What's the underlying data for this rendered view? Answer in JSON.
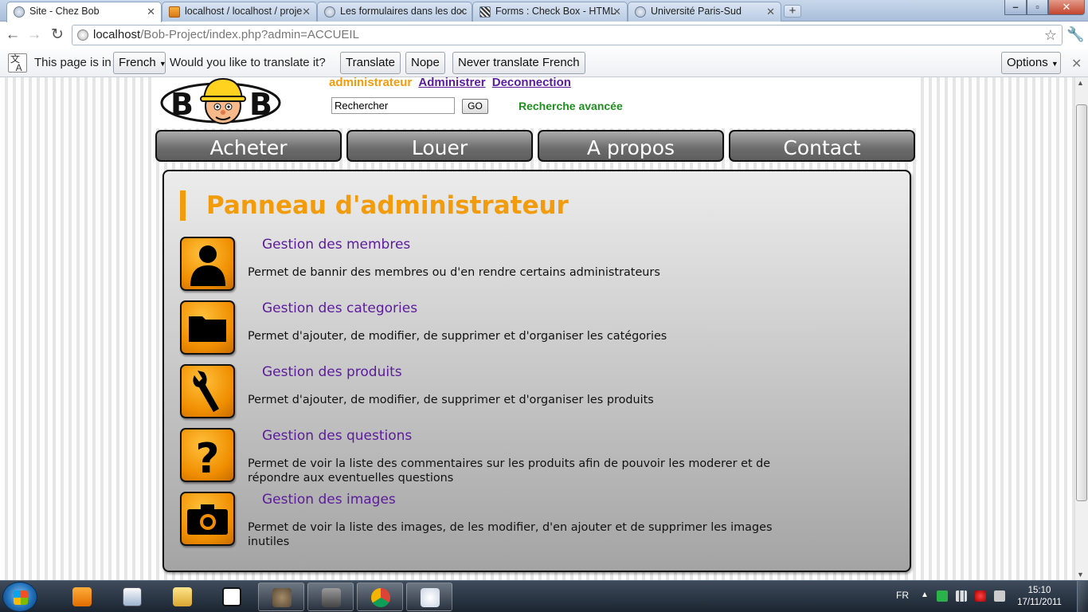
{
  "browser": {
    "tabs": [
      {
        "title": "Site - Chez Bob",
        "icon": "globe-icon",
        "active": true
      },
      {
        "title": "localhost / localhost / proje",
        "icon": "phpmyadmin-icon",
        "active": false
      },
      {
        "title": "Les formulaires dans les doc",
        "icon": "globe-icon",
        "active": false
      },
      {
        "title": "Forms : Check Box - HTML",
        "icon": "site-icon",
        "active": false
      },
      {
        "title": "Université Paris-Sud",
        "icon": "globe-icon",
        "active": false
      }
    ],
    "address": {
      "host": "localhost",
      "path": "/Bob-Project/index.php?admin=ACCUEIL"
    }
  },
  "translate_bar": {
    "prefix": "This page is in",
    "language": "French",
    "question": "Would you like to translate it?",
    "translate_label": "Translate",
    "nope_label": "Nope",
    "never_label": "Never translate French",
    "options_label": "Options"
  },
  "site": {
    "logo_text": "BOB",
    "user": {
      "name": "administrateur",
      "admin_link": "Administrer",
      "logout_link": "Deconnection"
    },
    "search": {
      "value": "Rechercher",
      "go_label": "GO",
      "advanced_label": "Recherche avancée"
    },
    "nav": [
      "Acheter",
      "Louer",
      "A propos",
      "Contact"
    ],
    "panel": {
      "title": "Panneau d'administrateur",
      "items": [
        {
          "title": "Gestion des membres",
          "description": "Permet de bannir des membres ou d'en rendre certains administrateurs",
          "icon": "user-icon"
        },
        {
          "title": "Gestion des categories",
          "description": "Permet d'ajouter, de modifier, de supprimer et d'organiser les catégories",
          "icon": "folder-icon"
        },
        {
          "title": "Gestion des produits",
          "description": "Permet d'ajouter, de modifier, de supprimer et d'organiser les produits",
          "icon": "wrench-icon"
        },
        {
          "title": "Gestion des questions",
          "description": "Permet de voir la liste des commentaires sur les produits afin de pouvoir les moderer et de répondre aux eventuelles questions",
          "icon": "question-icon"
        },
        {
          "title": "Gestion des images",
          "description": "Permet de voir la liste des images, de les modifier, d'en ajouter et de supprimer les images inutiles",
          "icon": "camera-icon"
        }
      ]
    }
  },
  "taskbar": {
    "language": "FR",
    "time": "15:10",
    "date": "17/11/2011"
  },
  "colors": {
    "accent_orange": "#f29b0b",
    "link_purple": "#5b1b9b",
    "advanced_green": "#1f8f1f"
  }
}
